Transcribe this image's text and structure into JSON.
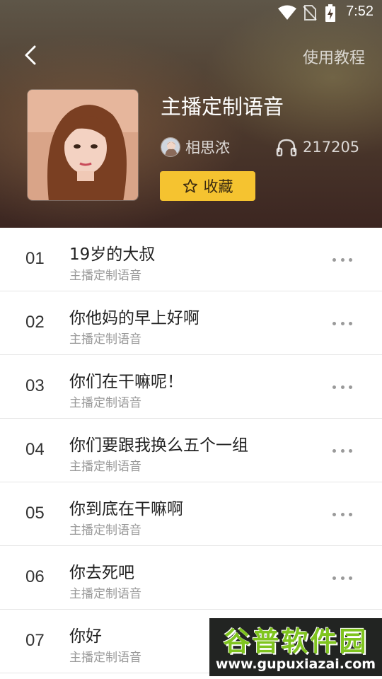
{
  "status_bar": {
    "time": "7:52"
  },
  "header": {
    "tutorial_label": "使用教程",
    "album_title": "主播定制语音",
    "author_name": "相思浓",
    "play_count": "217205",
    "favorite_label": "收藏"
  },
  "tracks": [
    {
      "num": "01",
      "title": "19岁的大叔",
      "subtitle": "主播定制语音"
    },
    {
      "num": "02",
      "title": "你他妈的早上好啊",
      "subtitle": "主播定制语音"
    },
    {
      "num": "03",
      "title": "你们在干嘛呢！",
      "subtitle": "主播定制语音"
    },
    {
      "num": "04",
      "title": "你们要跟我换么五个一组",
      "subtitle": "主播定制语音"
    },
    {
      "num": "05",
      "title": "你到底在干嘛啊",
      "subtitle": "主播定制语音"
    },
    {
      "num": "06",
      "title": "你去死吧",
      "subtitle": "主播定制语音"
    },
    {
      "num": "07",
      "title": "你好",
      "subtitle": "主播定制语音"
    }
  ],
  "watermark": {
    "title": "谷普软件园",
    "url": "www.gupuxiazai.com"
  },
  "colors": {
    "accent": "#f5c330",
    "header_dark": "#3c2621"
  }
}
